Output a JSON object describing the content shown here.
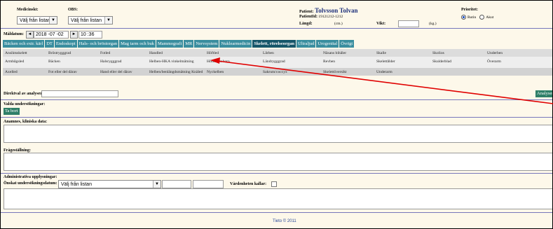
{
  "header": {
    "remitter_label": "Medicinskt:",
    "remitter_value": "Välj från listan",
    "obs_label": "OBS:",
    "obs_value": "Välj från listan",
    "patient_label": "Patient:",
    "patient_name": "Tolvsson Tolvan",
    "patient_id_label": "PatientId:",
    "patient_id": "19121212-1212",
    "height_label": "Längd:",
    "height_unit": "(cm.)",
    "weight_label": "Vikt:",
    "weight_unit": "(kg.)",
    "priority_label": "Prioritet:",
    "priority_options": [
      "Rutin",
      "Akut"
    ]
  },
  "datetime": {
    "label": "Måldatum:",
    "date": "2018 -07 -02",
    "time": "10 :36",
    "prev": "◄",
    "next": "►"
  },
  "tabs": [
    {
      "label": "Bäcken och extr. kärl",
      "active": false
    },
    {
      "label": "DT",
      "active": false
    },
    {
      "label": "Endoskopi",
      "active": false
    },
    {
      "label": "Hals- och bröstorgan",
      "active": false
    },
    {
      "label": "Mag tarm och buk",
      "active": false
    },
    {
      "label": "Mammografi",
      "active": false
    },
    {
      "label": "MR",
      "active": false
    },
    {
      "label": "Nervsystem",
      "active": false
    },
    {
      "label": "Nuklearmedicin",
      "active": false
    },
    {
      "label": "Skelett, rörelseorgan",
      "active": true
    },
    {
      "label": "Ultraljud",
      "active": false
    },
    {
      "label": "Urogenital",
      "active": false
    },
    {
      "label": "Övrigt",
      "active": false
    }
  ],
  "exam_grid": [
    [
      "Ansiktsskelett",
      "Bröstrygggrad",
      "Fotled",
      "Handled",
      "Höftled",
      "Lårben",
      "Näsans bihåler",
      "Skalle",
      "Skolios",
      "Underben"
    ],
    [
      "Armbågsled",
      "Bäcken",
      "Halsrygggrad",
      "Helben-HKA vinkelmätning",
      "Höftleder barn",
      "Ländrygggrad",
      "Revben",
      "Skelettålder",
      "Skulderblad",
      "Överarm"
    ],
    [
      "Axelled",
      "Fot eller del därav",
      "Hand eller del därav",
      "Helben/benlängdsmätning Knäled",
      "Nyckelben",
      "Sakrum/coccyx",
      "Skelettöversikt",
      "Underarm",
      "",
      ""
    ]
  ],
  "direct_select": {
    "label": "Direktval av analyser:",
    "value": "",
    "button": "Analyser"
  },
  "selected_exams": {
    "label": "Valda undersökningar:",
    "remove_button": "Ta bort"
  },
  "anamnesis": {
    "label": "Anamnes, kliniska data:"
  },
  "question": {
    "label": "Frågeställning:"
  },
  "admin": {
    "label": "Administrativa upplysningar:",
    "exam_date_label": "Önskat undersökningsdatum:",
    "exam_date_value": "Välj från listan",
    "care_unit_label": "Vårdenheten kallar:"
  },
  "footer": {
    "copyright": "Tieto © 2011"
  },
  "colors": {
    "background": "#fdf8ea",
    "tab": "#3a8e9f",
    "tab_active": "#16576a",
    "annotation_arrow": "#e00000",
    "rule": "#7777bb"
  }
}
